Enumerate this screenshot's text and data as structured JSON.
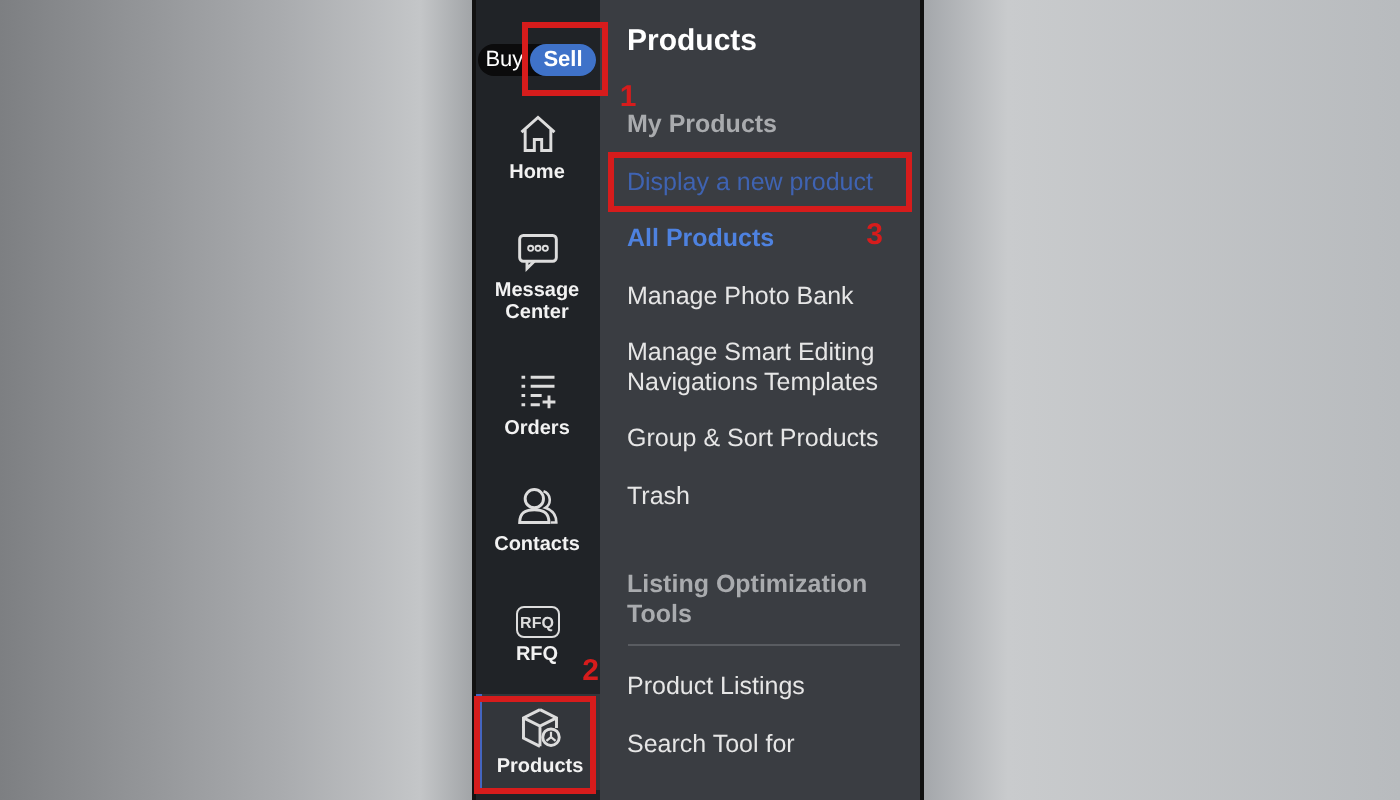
{
  "mode_toggle": {
    "options": [
      {
        "label": "Buy",
        "selected": false
      },
      {
        "label": "Sell",
        "selected": true,
        "callout": "1"
      }
    ]
  },
  "rail": [
    {
      "label": "Home",
      "selected": false
    },
    {
      "label": "Message Center",
      "selected": false
    },
    {
      "label": "Orders",
      "selected": false
    },
    {
      "label": "Contacts",
      "selected": false
    },
    {
      "label": "RFQ",
      "icon_text": "RFQ",
      "selected": false
    },
    {
      "label": "Products",
      "selected": true,
      "callout": "2"
    }
  ],
  "menu": {
    "title": "Products",
    "items": [
      {
        "label": "My Products",
        "kind": "section"
      },
      {
        "label": "Display a new product",
        "kind": "link",
        "callout": "3"
      },
      {
        "label": "All Products",
        "kind": "active"
      },
      {
        "label": "Manage Photo Bank",
        "kind": "item"
      },
      {
        "label": "Manage Smart Editing Navigations Templates",
        "kind": "item"
      },
      {
        "label": "Group & Sort Products",
        "kind": "item"
      },
      {
        "label": "Trash",
        "kind": "item"
      },
      {
        "label": "Listing Optimization Tools",
        "kind": "section",
        "divider": true
      },
      {
        "label": "Product Listings",
        "kind": "item"
      },
      {
        "label": "Search Tool for",
        "kind": "item"
      }
    ]
  }
}
